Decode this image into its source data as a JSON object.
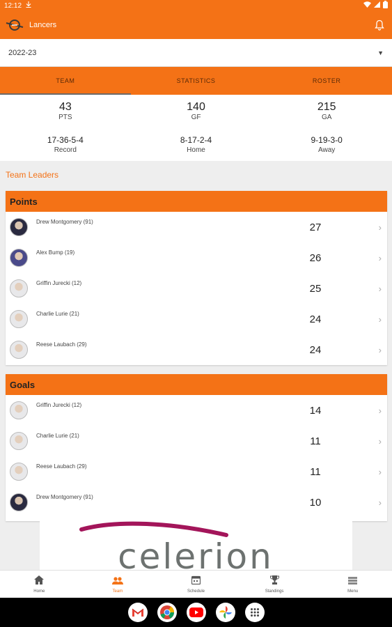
{
  "status_bar": {
    "time": "12:12"
  },
  "app_bar": {
    "title": "Lancers"
  },
  "season": {
    "value": "2022-23"
  },
  "tabs": [
    {
      "label": "TEAM",
      "active": true
    },
    {
      "label": "STATISTICS",
      "active": false
    },
    {
      "label": "ROSTER",
      "active": false
    }
  ],
  "stats": {
    "row1": [
      {
        "value": "43",
        "label": "PTS"
      },
      {
        "value": "140",
        "label": "GF"
      },
      {
        "value": "215",
        "label": "GA"
      }
    ],
    "row2": [
      {
        "value": "17-36-5-4",
        "label": "Record"
      },
      {
        "value": "8-17-2-4",
        "label": "Home"
      },
      {
        "value": "9-19-3-0",
        "label": "Away"
      }
    ]
  },
  "leaders": {
    "section_label": "Team Leaders",
    "points": {
      "title": "Points",
      "rows": [
        {
          "name": "Drew Montgomery (91)",
          "value": "27"
        },
        {
          "name": "Alex Bump (19)",
          "value": "26"
        },
        {
          "name": "Griffin Jurecki (12)",
          "value": "25"
        },
        {
          "name": "Charlie Lurie (21)",
          "value": "24"
        },
        {
          "name": "Reese Laubach (29)",
          "value": "24"
        }
      ]
    },
    "goals": {
      "title": "Goals",
      "rows": [
        {
          "name": "Griffin Jurecki (12)",
          "value": "14"
        },
        {
          "name": "Charlie Lurie (21)",
          "value": "11"
        },
        {
          "name": "Reese Laubach (29)",
          "value": "11"
        },
        {
          "name": "Drew Montgomery (91)",
          "value": "10"
        }
      ]
    }
  },
  "ad": {
    "brand": "celerion",
    "colors": {
      "swoosh": "#a3155a",
      "text": "#6d7270"
    }
  },
  "bottom_nav": [
    {
      "label": "Home",
      "icon": "home-icon",
      "active": false
    },
    {
      "label": "Team",
      "icon": "team-icon",
      "active": true
    },
    {
      "label": "Schedule",
      "icon": "calendar-icon",
      "active": false
    },
    {
      "label": "Standings",
      "icon": "trophy-icon",
      "active": false
    },
    {
      "label": "Menu",
      "icon": "menu-icon",
      "active": false
    }
  ],
  "dock_apps": [
    "gmail-icon",
    "chrome-icon",
    "youtube-icon",
    "photos-icon",
    "app-drawer-icon"
  ],
  "colors": {
    "accent": "#f47216",
    "tab_text": "#5a2a08"
  }
}
